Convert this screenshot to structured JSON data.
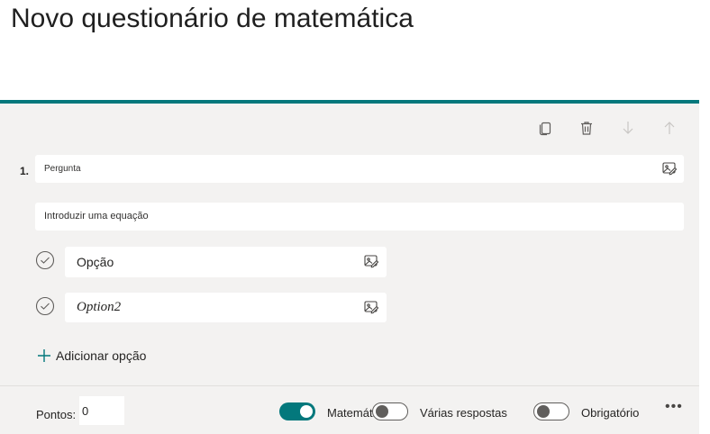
{
  "page": {
    "title": "Novo questionário de matemática"
  },
  "colors": {
    "accent": "#03787c",
    "card_bg": "#f3f2f1",
    "text": "#252423"
  },
  "toolbar": {
    "copy_icon": "copy-icon",
    "delete_icon": "trash-icon",
    "move_down_icon": "arrow-down-icon",
    "move_up_icon": "arrow-up-icon"
  },
  "question": {
    "number": "1.",
    "placeholder": "Pergunta",
    "equation_placeholder": "Introduzir uma equação",
    "options": [
      {
        "label": "Opção",
        "style": "normal"
      },
      {
        "label": "Option2",
        "style": "math"
      }
    ],
    "add_option_label": "Adicionar opção"
  },
  "footer": {
    "points_label": "Pontos:",
    "points_value": "0",
    "toggles": [
      {
        "label": "Matemática",
        "on": true
      },
      {
        "label": "Várias respostas",
        "on": false
      },
      {
        "label": "Obrigatório",
        "on": false
      }
    ],
    "more_label": "•••"
  }
}
